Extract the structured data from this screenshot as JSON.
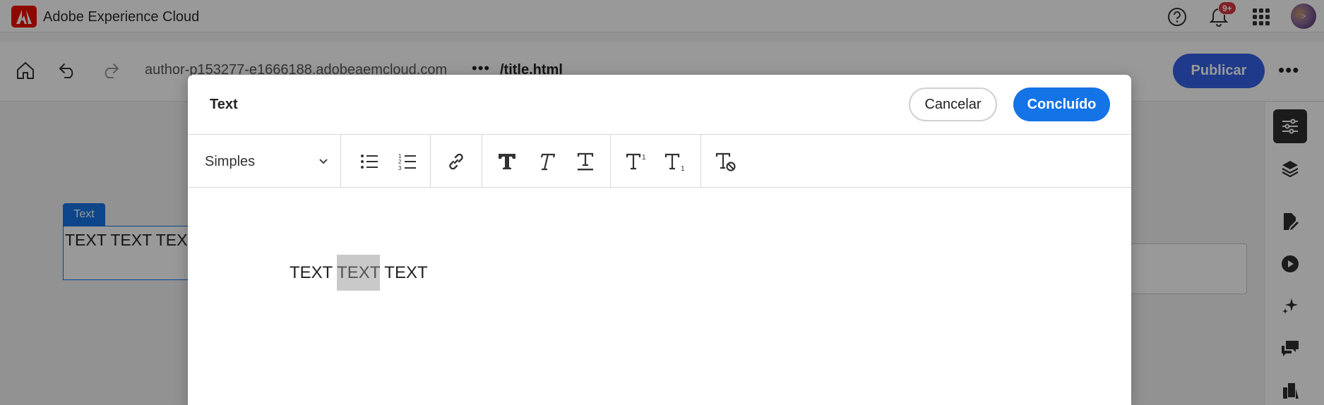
{
  "app": {
    "title": "Adobe Experience Cloud",
    "notifications_badge": "9+",
    "avatar_initials": ">"
  },
  "editor_bar": {
    "url_host": "author-p153277-e1666188.adobeaemcloud.com",
    "url_dots": "•••",
    "url_path": "/title.html",
    "publish_label": "Publicar",
    "more_label": "•••"
  },
  "page_component": {
    "tag_label": "Text",
    "content": "TEXT TEXT TEXT"
  },
  "dialog": {
    "title": "Text",
    "cancel_label": "Cancelar",
    "done_label": "Concluído",
    "paragraph_format": "Simples",
    "toolbar_icons": [
      "bullet-list-icon",
      "numbered-list-icon",
      "link-icon",
      "bold-icon",
      "italic-icon",
      "underline-icon",
      "superscript-icon",
      "subscript-icon",
      "clear-format-icon"
    ],
    "text_before": "TEXT ",
    "text_selected": "TEXT",
    "text_after": " TEXT"
  },
  "colors": {
    "brand_red": "#eb1000",
    "primary_blue": "#1473e6",
    "publish_blue": "#3562e7",
    "overlay": "rgba(0,0,0,0.4)"
  }
}
